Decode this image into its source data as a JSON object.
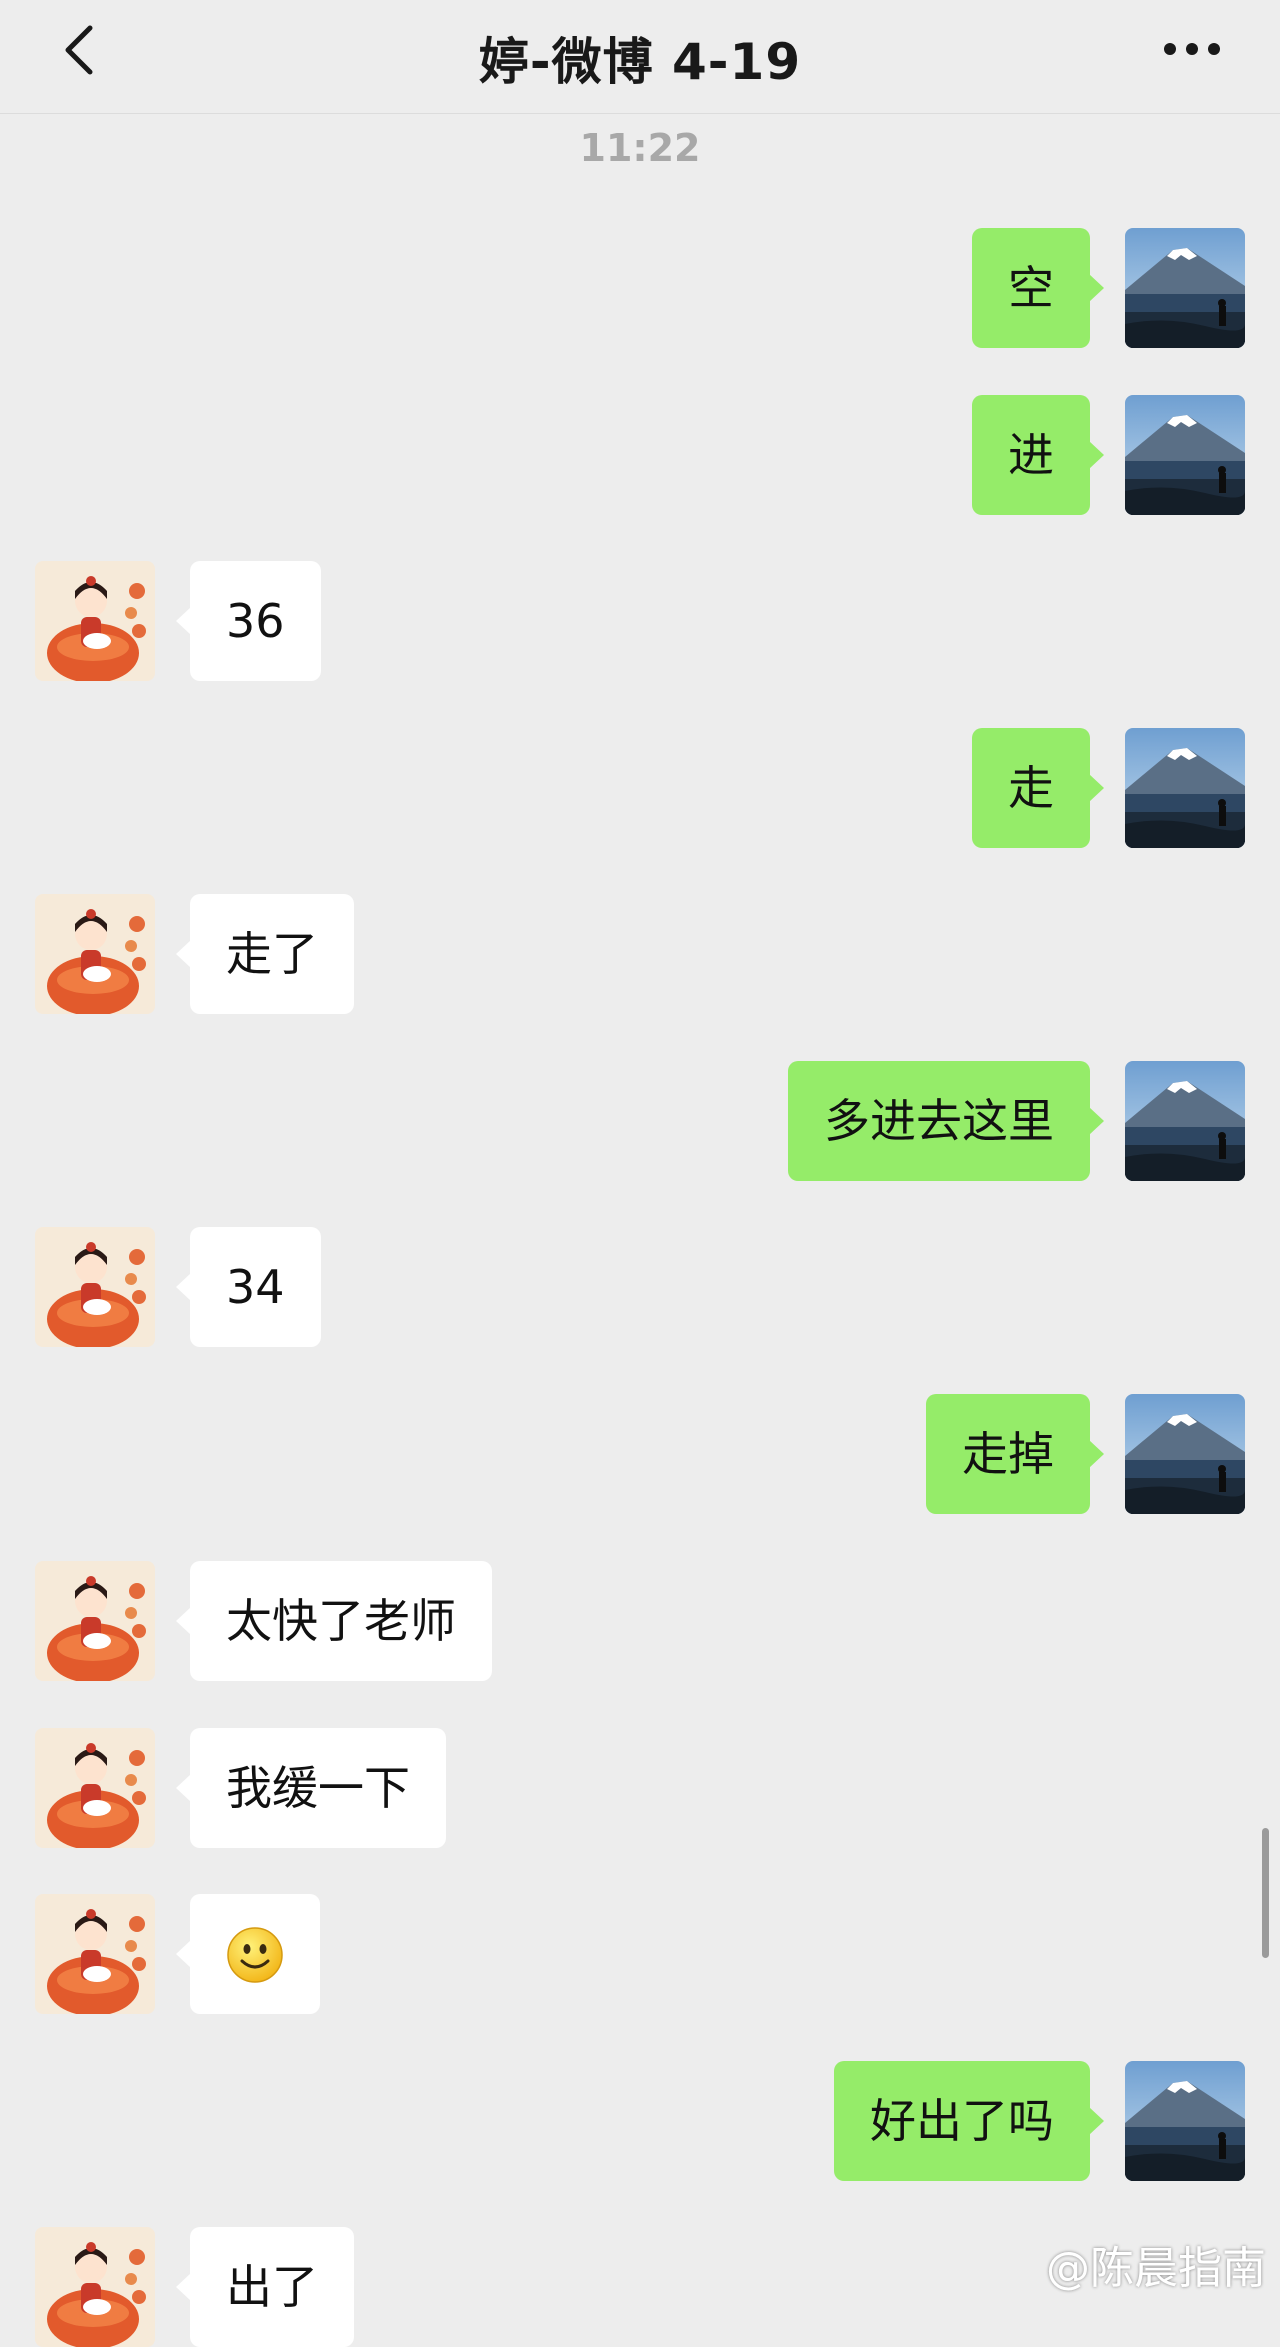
{
  "header": {
    "title": "婷-微博 4-19",
    "back_icon": "chevron-left-icon",
    "more_icon": "more-dots-icon"
  },
  "timestamp": "11:22",
  "messages": [
    {
      "side": "out",
      "text": "空"
    },
    {
      "side": "out",
      "text": "进"
    },
    {
      "side": "in",
      "text": "36"
    },
    {
      "side": "out",
      "text": "走"
    },
    {
      "side": "in",
      "text": "走了"
    },
    {
      "side": "out",
      "text": "多进去这里"
    },
    {
      "side": "in",
      "text": "34"
    },
    {
      "side": "out",
      "text": "走掉"
    },
    {
      "side": "in",
      "text": "太快了老师"
    },
    {
      "side": "in",
      "text": "我缓一下"
    },
    {
      "side": "in",
      "text": "",
      "emoji": "smiley-emoji-icon"
    },
    {
      "side": "out",
      "text": "好出了吗"
    },
    {
      "side": "in",
      "text": "出了"
    }
  ],
  "watermark": "@陈晨指南",
  "colors": {
    "background": "#ededed",
    "outgoing_bubble": "#95ec69",
    "incoming_bubble": "#ffffff",
    "timestamp_text": "#a8a8a8"
  }
}
